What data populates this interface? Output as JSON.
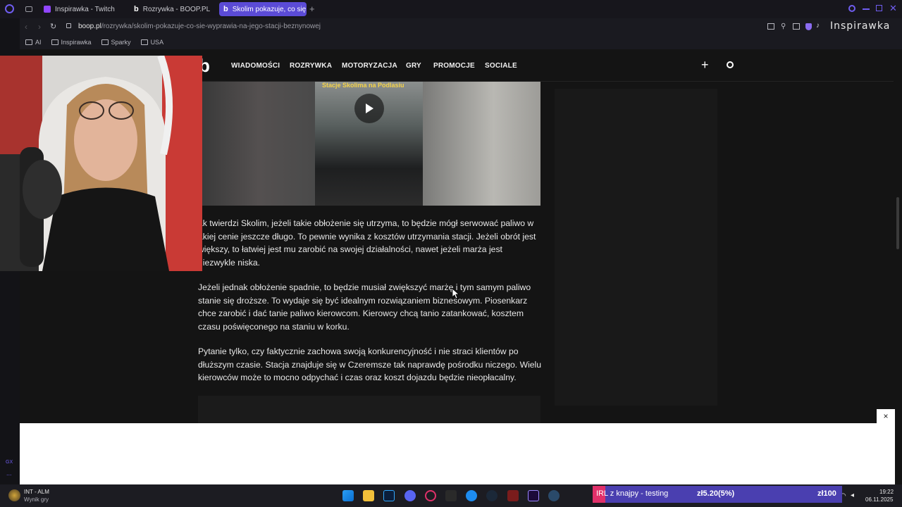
{
  "tabs": [
    {
      "label": "Inspirawka - Twitch"
    },
    {
      "label": "Rozrywka - BOOP.PL"
    },
    {
      "label": "Skolim pokazuje, co się »"
    }
  ],
  "address": {
    "domain": "boop.pl",
    "path": "/rozrywka/skolim-pokazuje-co-sie-wyprawia-na-jego-stacji-beznynowej"
  },
  "watermark": "Inspirawka",
  "bookmarks": [
    {
      "label": "AI"
    },
    {
      "label": "Inspirawka"
    },
    {
      "label": "Sparky"
    },
    {
      "label": "USA"
    }
  ],
  "site": {
    "logo": "b",
    "nav": [
      "WIADOMOŚCI",
      "ROZRYWKA",
      "MOTORYZACJA",
      "GRY",
      "PROMOCJE",
      "SOCIALE"
    ]
  },
  "video": {
    "caption": "Stacje Skolima na Podlasiu"
  },
  "article": {
    "paragraphs": [
      "ak twierdzi Skolim, jeżeli takie obłożenie się utrzyma, to będzie mógł serwować paliwo w akiej cenie jeszcze długo. To pewnie wynika z kosztów utrzymania stacji. Jeżeli obrót jest większy, to łatwiej jest mu zarobić na swojej działalności, nawet jeżeli marża jest niezwykle niska.",
      "Jeżeli jednak obłożenie spadnie, to będzie musiał zwiększyć marżę i tym samym paliwo stanie się droższe. To wydaje się być idealnym rozwiązaniem biznesowym. Piosenkarz chce zarobić i dać tanie paliwo kierowcom. Kierowcy chcą tanio zatankować, kosztem czasu poświęconego na staniu w korku.",
      "Pytanie tylko, czy faktycznie zachowa swoją konkurencyjność i nie straci klientów po dłuższym czasie. Stacja znajduje się w Czeremsze tak naprawdę pośrodku niczego. Wielu kierowców może to mocno odpychać i czas oraz koszt dojazdu będzie nieopłacalny."
    ]
  },
  "ad": {
    "close_label": "×"
  },
  "taskbar": {
    "game_title": "INT - ALM",
    "game_subtitle": "Wynik gry",
    "clock_time": "19:22",
    "clock_date": "06.11.2025"
  },
  "stream_alert": {
    "title": "IRL z knajpy - testing",
    "amount": "zł5.20(5%)",
    "goal": "zł100"
  },
  "sidebar_labels": {
    "gx": "GX",
    "more": "..."
  },
  "colors": {
    "accent": "#5b4bd6",
    "page_bg": "#141414",
    "alert_bg": "#4a3fb0"
  }
}
